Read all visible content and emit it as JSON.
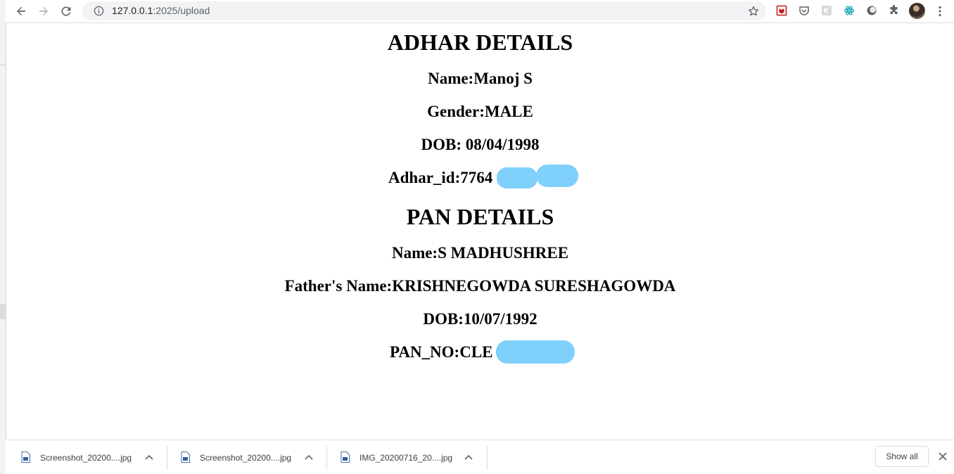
{
  "browser": {
    "url_host": "127.0.0.1",
    "url_path": ":2025/upload"
  },
  "adhar": {
    "heading": "ADHAR DETAILS",
    "name": "Name:Manoj S",
    "gender": "Gender:MALE",
    "dob": "DOB: 08/04/1998",
    "id": "Adhar_id:7764"
  },
  "pan": {
    "heading": "PAN DETAILS",
    "name": "Name:S MADHUSHREE",
    "father": "Father's Name:KRISHNEGOWDA SURESHAGOWDA",
    "dob": "DOB:10/07/1992",
    "number": "PAN_NO:CLE"
  },
  "downloads": {
    "items": [
      {
        "name": "Screenshot_20200....jpg"
      },
      {
        "name": "Screenshot_20200....jpg"
      },
      {
        "name": "IMG_20200716_20....jpg"
      }
    ],
    "show_all": "Show all"
  },
  "colors": {
    "redaction": "#7fd0fb",
    "toolbar_bg": "#ffffff",
    "omnibox_bg": "#f1f3f4"
  }
}
